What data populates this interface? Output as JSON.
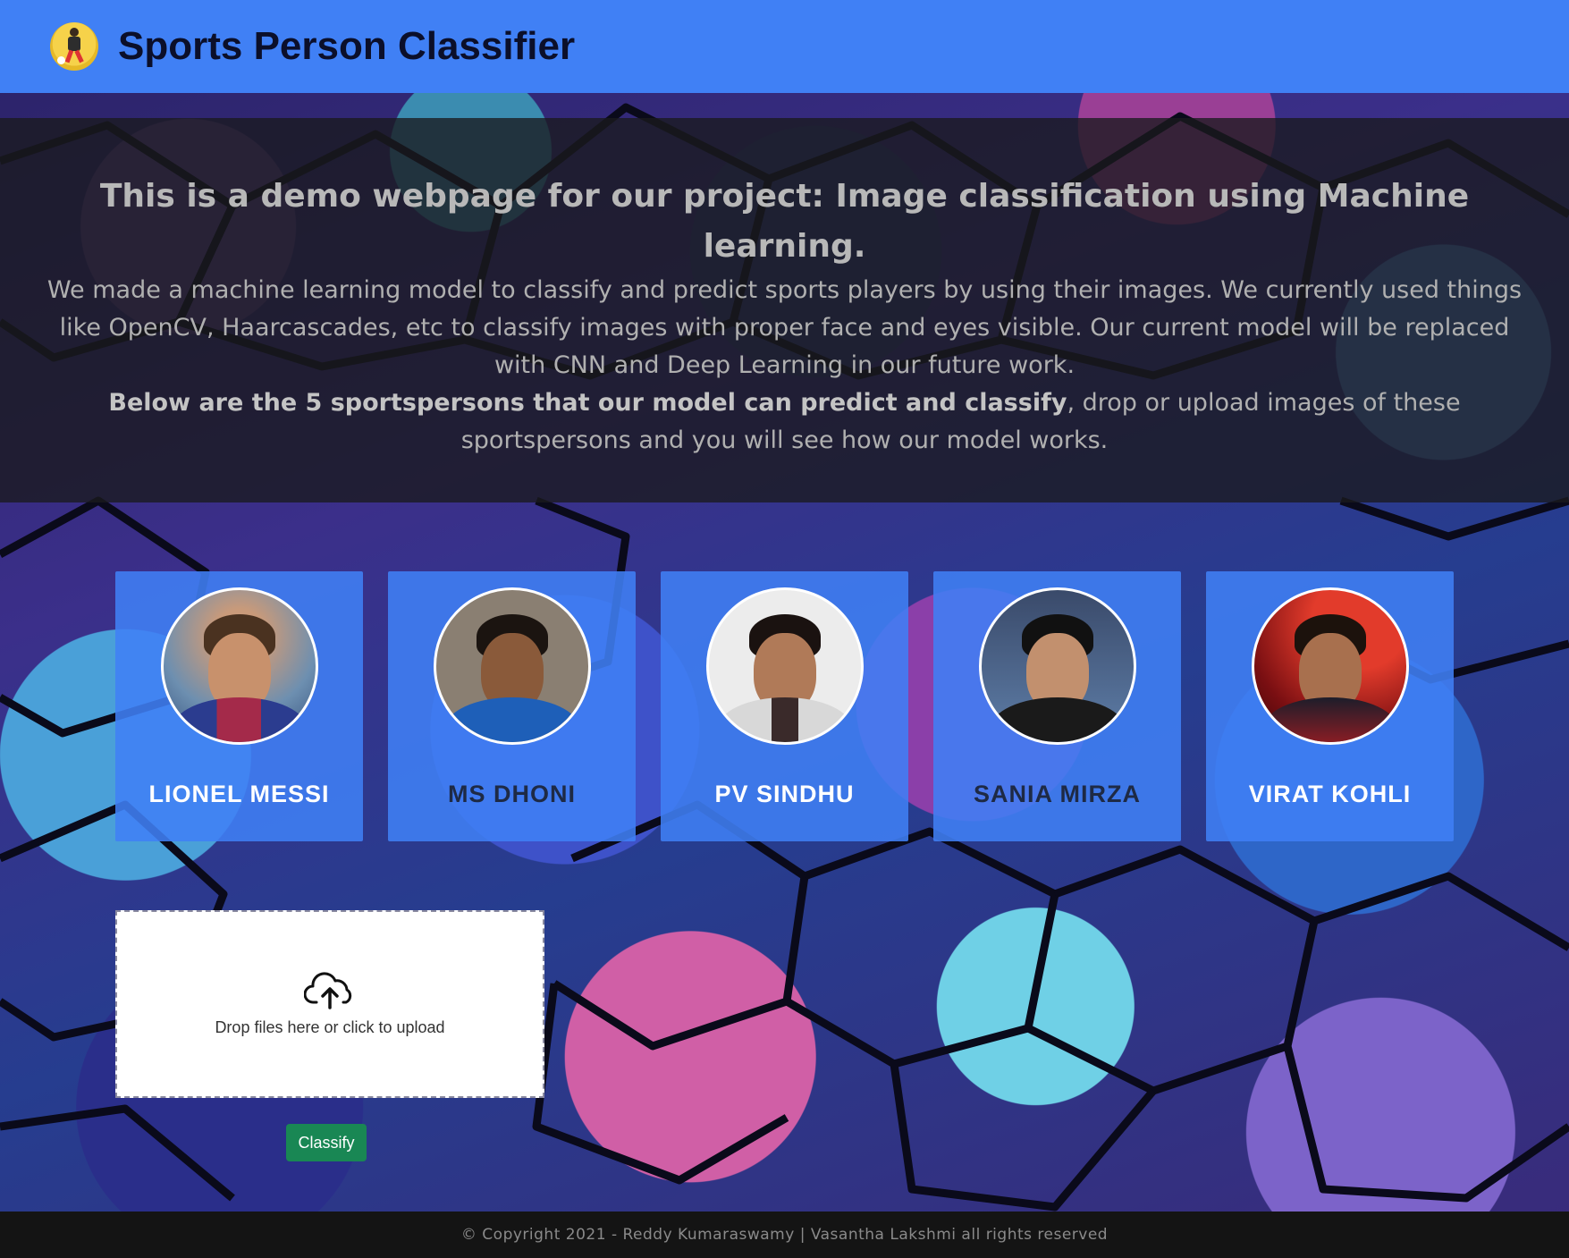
{
  "header": {
    "logo_icon": "soccer-player-icon",
    "title": "Sports Person Classifier",
    "background_color": "#4080f5"
  },
  "intro": {
    "heading": "This is a demo webpage for our project: Image classification using Machine learning.",
    "paragraph1": "We made a machine learning model to classify and predict sports players by using their images. We currently used things like OpenCV, Haarcascades, etc to classify images with proper face and eyes visible. Our current model will be replaced with CNN and Deep Learning in our future work.",
    "paragraph2_bold": "Below are the 5 sportspersons that our model can predict and classify",
    "paragraph2_rest": ", drop or upload images of these sportspersons and you will see how our model works."
  },
  "players": [
    {
      "name": "LIONEL MESSI"
    },
    {
      "name": "MS DHONI"
    },
    {
      "name": "PV SINDHU"
    },
    {
      "name": "SANIA MIRZA"
    },
    {
      "name": "VIRAT KOHLI"
    }
  ],
  "upload": {
    "icon": "cloud-upload-icon",
    "text": "Drop files here or click to upload"
  },
  "classify_button": {
    "label": "Classify",
    "color": "#198754"
  },
  "footer": {
    "text": "© Copyright 2021 - Reddy Kumaraswamy | Vasantha Lakshmi all rights reserved"
  }
}
